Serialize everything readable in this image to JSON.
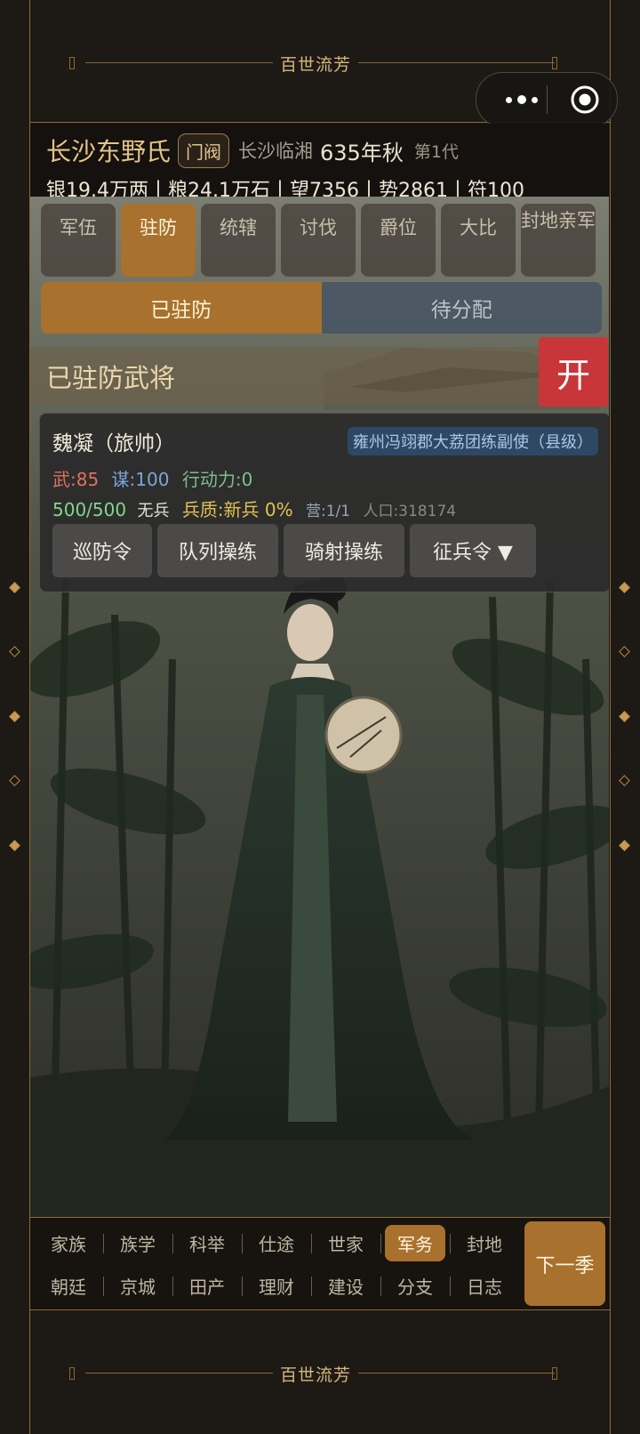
{
  "frame": {
    "seal": "百世流芳"
  },
  "header": {
    "family_name": "长沙东野氏",
    "rank_badge": "门阀",
    "location": "长沙临湘",
    "year": "635年秋",
    "generation": "第1代",
    "resources": "银19.4万两丨粮24.1万石丨望7356丨势2861丨符100"
  },
  "tabs": [
    {
      "label": "军伍"
    },
    {
      "label": "驻防"
    },
    {
      "label": "统辖"
    },
    {
      "label": "讨伐"
    },
    {
      "label": "爵位"
    },
    {
      "label": "大比"
    },
    {
      "label": "封地亲军"
    }
  ],
  "active_tab": "驻防",
  "subtabs": {
    "stationed": "已驻防",
    "pending": "待分配"
  },
  "section": {
    "title": "已驻防武将",
    "toggle_label": "开"
  },
  "general": {
    "name": "魏凝（旅帅）",
    "title": "雍州冯翊郡大荔团练副使（县级）",
    "force": "武:85",
    "strategy": "谋:100",
    "action_points": "行动力:0",
    "troops": "500/500",
    "troop_type": "无兵",
    "quality": "兵质:新兵 0%",
    "camp": "营:1/1",
    "population": "人口:318174",
    "actions": [
      "巡防令",
      "队列操练",
      "骑射操练",
      "征兵令 ▼"
    ]
  },
  "bottom_nav": {
    "row1": [
      "家族",
      "族学",
      "科举",
      "仕途",
      "世家",
      "军务",
      "封地"
    ],
    "row2": [
      "朝廷",
      "京城",
      "田产",
      "理财",
      "建设",
      "分支",
      "日志"
    ],
    "active": "军务",
    "next_season": "下一季"
  },
  "colors": {
    "accent": "#a8712d",
    "background": "#1d1915",
    "force": "#e0705f",
    "strategy": "#7aa7d8",
    "action": "#7fbd8f",
    "troops": "#84d48e",
    "quality": "#e3c255",
    "toggle": "#c8363a"
  },
  "icons": {
    "menu": "more-dots-icon",
    "close": "target-circle-icon"
  }
}
